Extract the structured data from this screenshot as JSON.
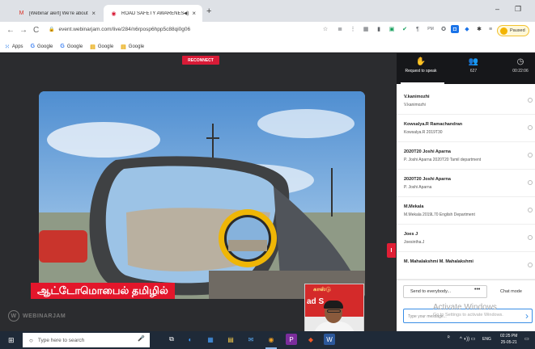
{
  "browser": {
    "tabs": [
      {
        "title": "[Webinar alert] We're about to st",
        "favicon": "gmail-icon",
        "active": false
      },
      {
        "title": "ROAD SAFETY AWARENESS",
        "favicon": "webinarjam-icon",
        "active": true
      }
    ],
    "url": "event.webinarjam.com/live/284/n6rposp6hpp5c88qi0g06",
    "paused_label": "Paused",
    "bookmarks": [
      {
        "label": "Apps",
        "icon": "apps-icon"
      },
      {
        "label": "Google",
        "icon": "google-icon"
      },
      {
        "label": "Google",
        "icon": "google-icon"
      },
      {
        "label": "Google",
        "icon": "folder-icon"
      },
      {
        "label": "Google",
        "icon": "folder-icon"
      }
    ],
    "colors": {
      "tabstrip": "#dee1e6",
      "accent_red": "#d81b37"
    }
  },
  "stage": {
    "reconnect_label": "RECONNECT",
    "caption": "ஆட்டோமொபைல் தமிழில்",
    "pip_banner_title": "காஸ்டு",
    "pip_banner_side": "ad S",
    "brand": "WEBINARJAM",
    "side_tab": "I"
  },
  "panel": {
    "header": [
      {
        "icon": "hand-icon",
        "label": "Request to speak"
      },
      {
        "icon": "attendees-icon",
        "label": "627"
      },
      {
        "icon": "clock-icon",
        "label": "00:22:06"
      }
    ],
    "participants": [
      {
        "name": "V.kanimozhi",
        "sub": "V.kanimozhi"
      },
      {
        "name": "Kowsalya.R Ramachandran",
        "sub": "Kowsalya.R 2019T30"
      },
      {
        "name": "2020T20 Joshi Aparna",
        "sub": "P. Joshi Aparna 2020T20 Tamil department"
      },
      {
        "name": "2020T20 Joshi Aparna",
        "sub": "P. Joshi Aparna"
      },
      {
        "name": "M.Mekala",
        "sub": "M.Mekala 2019L70 English Department"
      },
      {
        "name": "Joes J",
        "sub": "Joesintha.J"
      },
      {
        "name": "M. Mahalakshmi M. Mahalakshmi",
        "sub": ""
      }
    ],
    "send_to": "Send to everybody...",
    "more": "•••",
    "chat_mode": "Chat mode",
    "message_placeholder": "Type your message...",
    "watermark_title": "Activate Windows",
    "watermark_sub": "Go to Settings to activate Windows."
  },
  "taskbar": {
    "search_placeholder": "Type here to search",
    "tray_lang": "ENG",
    "time": "02:25 PM",
    "date": "25-05-21",
    "colors": {
      "bar": "#1f2a38"
    }
  }
}
